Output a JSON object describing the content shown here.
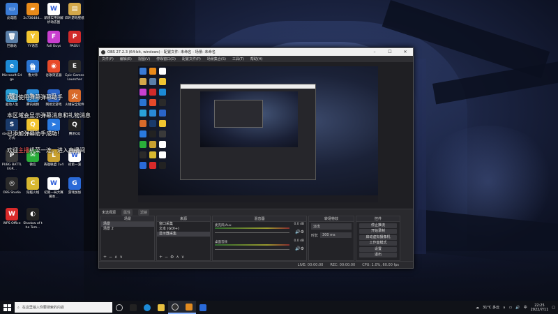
{
  "desktop_icons": [
    {
      "label": "此电脑",
      "color": "#3a7bd5",
      "glyph": "▭"
    },
    {
      "label": "2c736484...",
      "color": "#e88a1a",
      "glyph": "▰"
    },
    {
      "label": "新建实用诗解析动态图",
      "color": "#ffffff",
      "glyph": "W"
    },
    {
      "label": "四叶游戏壁纸",
      "color": "#d4a84a",
      "glyph": "▤"
    },
    {
      "label": "回收站",
      "color": "#5a7fa8",
      "glyph": "🗑"
    },
    {
      "label": "YY语音",
      "color": "#f2c530",
      "glyph": "Y"
    },
    {
      "label": "Fall Guys",
      "color": "#c93fcf",
      "glyph": "F"
    },
    {
      "label": "PAGUI",
      "color": "#d12a2a",
      "glyph": "P"
    },
    {
      "label": "Microsoft Edge",
      "color": "#1c8ad6",
      "glyph": "e"
    },
    {
      "label": "鲁大师",
      "color": "#2a74d1",
      "glyph": "鲁"
    },
    {
      "label": "谷歌浏览器",
      "color": "#e84a2a",
      "glyph": "◉"
    },
    {
      "label": "Epic Games Launcher",
      "color": "#2a2a2a",
      "glyph": "E"
    },
    {
      "label": "驱动人生",
      "color": "#2aa0d8",
      "glyph": "驱"
    },
    {
      "label": "腾讯视频",
      "color": "#2a8ad8",
      "glyph": "▶"
    },
    {
      "label": "网易云游戏",
      "color": "#2a64c8",
      "glyph": "云"
    },
    {
      "label": "火绒安全软件",
      "color": "#d86a2a",
      "glyph": "火"
    },
    {
      "label": "steam - 快捷方式",
      "color": "#1a3a6a",
      "glyph": "S"
    },
    {
      "label": "QQ音乐",
      "color": "#f2c530",
      "glyph": "Q"
    },
    {
      "label": "迅雷",
      "color": "#2a7ae0",
      "glyph": "➤"
    },
    {
      "label": "腾讯QQ",
      "color": "#222222",
      "glyph": "Q"
    },
    {
      "label": "PUBG BATTLEGR...",
      "color": "#3a3a3a",
      "glyph": "P"
    },
    {
      "label": "微信",
      "color": "#2aae3a",
      "glyph": "✉"
    },
    {
      "label": "英雄联盟 1v4",
      "color": "#c8a030",
      "glyph": "L"
    },
    {
      "label": "初第一波",
      "color": "#ffffff",
      "glyph": "W"
    },
    {
      "label": "OBS Studio",
      "color": "#2a2a2a",
      "glyph": "◎"
    },
    {
      "label": "穿越火线",
      "color": "#d8b830",
      "glyph": "C"
    },
    {
      "label": "初第一局大赛脚本...",
      "color": "#ffffff",
      "glyph": "W"
    },
    {
      "label": "游戏加加",
      "color": "#2a6ad8",
      "glyph": "G"
    },
    {
      "label": "WPS Office",
      "color": "#d82a2a",
      "glyph": "W"
    },
    {
      "label": "Shadow of the Tom...",
      "color": "#222222",
      "glyph": "◐"
    }
  ],
  "danmaku": [
    {
      "text": "欢迎使用弹幕弹幕助手",
      "hl": ""
    },
    {
      "text": "本区域会显示弹幕消息和礼物消息",
      "hl": ""
    },
    {
      "text": "已添加弹幕助手成功!",
      "hl": ""
    },
    {
      "text": "欢迎",
      "hl": "主播",
      "rest": "机菜一连，进入直播间"
    }
  ],
  "obs": {
    "title": "OBS 27.2.3 (64-bit, windows) - 配置文件: 未命名 - 场景: 未命名",
    "menu": [
      "文件(F)",
      "编辑(E)",
      "视图(V)",
      "停靠窗口(D)",
      "配置文件(P)",
      "场景集合(S)",
      "工具(T)",
      "帮助(H)"
    ],
    "scene_bar_label": "未选择源",
    "scene_bar_tabs": [
      "属性",
      "滤镜"
    ],
    "docks": {
      "scenes": {
        "title": "场景",
        "items": [
          "场景",
          "场景 2"
        ],
        "selected": 0
      },
      "sources": {
        "title": "来源",
        "items": [
          "窗口采集",
          "文本 (GDI+)",
          "显示器采集"
        ],
        "selected": 2
      },
      "mixer": {
        "title": "混音器",
        "channels": [
          {
            "name": "麦克风/Aux",
            "db": "0.0 dB"
          },
          {
            "name": "桌面音频",
            "db": "0.0 dB"
          }
        ]
      },
      "transitions": {
        "title": "转场特效",
        "type": "淡出",
        "duration_label": "时长",
        "duration": "300 ms"
      },
      "controls": {
        "title": "控件",
        "buttons": [
          "停止推流",
          "开始录制",
          "启动虚拟摄像机",
          "工作室模式",
          "设置",
          "退出"
        ]
      }
    },
    "status": {
      "live": "LIVE: 00:00:00",
      "rec": "REC: 00:00:00",
      "cpu": "CPU: 1.0%, 60.00 fps"
    }
  },
  "taskbar": {
    "search_placeholder": "在这里输入你要搜索的内容",
    "temp": "31°C 多云",
    "time": "22:25",
    "date": "2022/7/11",
    "lang": "中"
  }
}
